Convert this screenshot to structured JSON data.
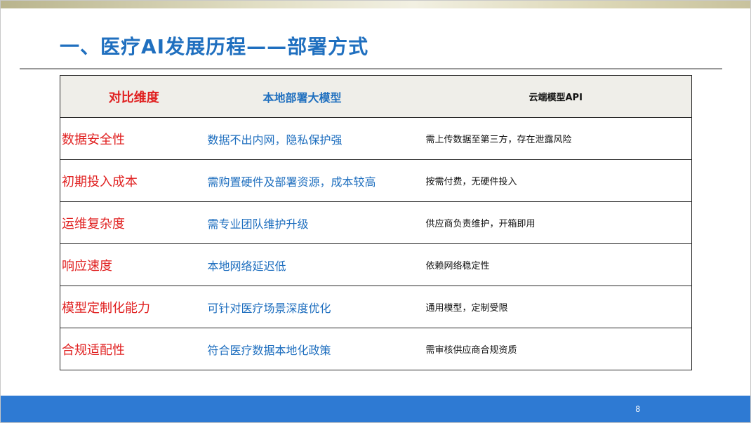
{
  "slide": {
    "title": "一、医疗AI发展历程——部署方式",
    "page_number": "8"
  },
  "table": {
    "headers": [
      "对比维度",
      "本地部署大模型",
      "云端模型API"
    ],
    "rows": [
      [
        "数据安全性",
        "数据不出内网，隐私保护强",
        "需上传数据至第三方，存在泄露风险"
      ],
      [
        "初期投入成本",
        "需购置硬件及部署资源，成本较高",
        "按需付费，无硬件投入"
      ],
      [
        "运维复杂度",
        "需专业团队维护升级",
        "供应商负责维护，开箱即用"
      ],
      [
        "响应速度",
        "本地网络延迟低",
        "依赖网络稳定性"
      ],
      [
        "模型定制化能力",
        "可针对医疗场景深度优化",
        "通用模型，定制受限"
      ],
      [
        "合规适配性",
        "符合医疗数据本地化政策",
        "需审核供应商合规资质"
      ]
    ]
  },
  "colors": {
    "title": "#1f6fbf",
    "dimension_text": "#e02020",
    "local_text": "#1f6fbf",
    "cloud_text": "#111111",
    "header_bg": "#efeee9",
    "footer_bar": "#2e7ad3"
  }
}
